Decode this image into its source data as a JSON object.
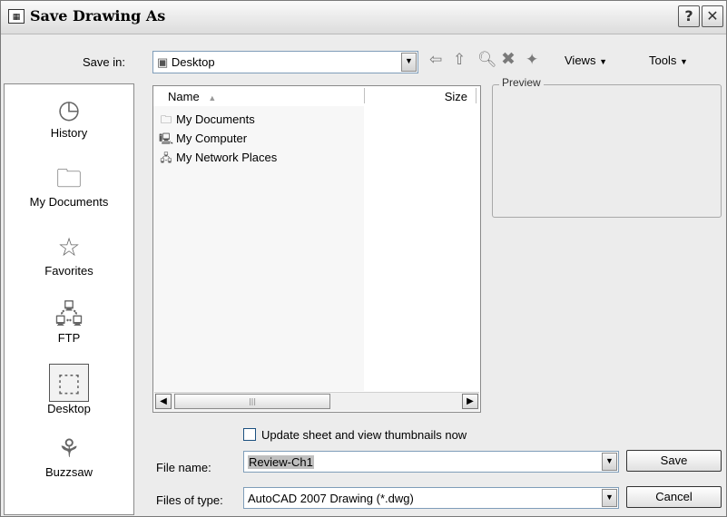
{
  "window": {
    "title": "Save Drawing As",
    "help_label": "?",
    "close_label": "✕"
  },
  "toolbar": {
    "save_in_label": "Save in:",
    "save_in_value": "Desktop",
    "views_label": "Views",
    "tools_label": "Tools"
  },
  "places": [
    {
      "label": "History",
      "icon": "history-icon"
    },
    {
      "label": "My Documents",
      "icon": "my-documents-icon"
    },
    {
      "label": "Favorites",
      "icon": "favorites-icon"
    },
    {
      "label": "FTP",
      "icon": "ftp-icon"
    },
    {
      "label": "Desktop",
      "icon": "desktop-icon",
      "selected": true
    },
    {
      "label": "Buzzsaw",
      "icon": "buzzsaw-icon"
    }
  ],
  "file_list": {
    "columns": [
      "Name",
      "Size"
    ],
    "items": [
      {
        "name": "My Documents",
        "icon": "folder-icon"
      },
      {
        "name": "My Computer",
        "icon": "computer-icon"
      },
      {
        "name": "My Network Places",
        "icon": "network-icon"
      }
    ]
  },
  "preview": {
    "label": "Preview"
  },
  "options": {
    "update_thumbnails_label": "Update sheet and view thumbnails now",
    "update_thumbnails_checked": false
  },
  "form": {
    "file_name_label": "File name:",
    "file_name_value": "Review-Ch1",
    "file_type_label": "Files of type:",
    "file_type_value": "AutoCAD 2007 Drawing (*.dwg)"
  },
  "buttons": {
    "save_label": "Save",
    "cancel_label": "Cancel"
  }
}
